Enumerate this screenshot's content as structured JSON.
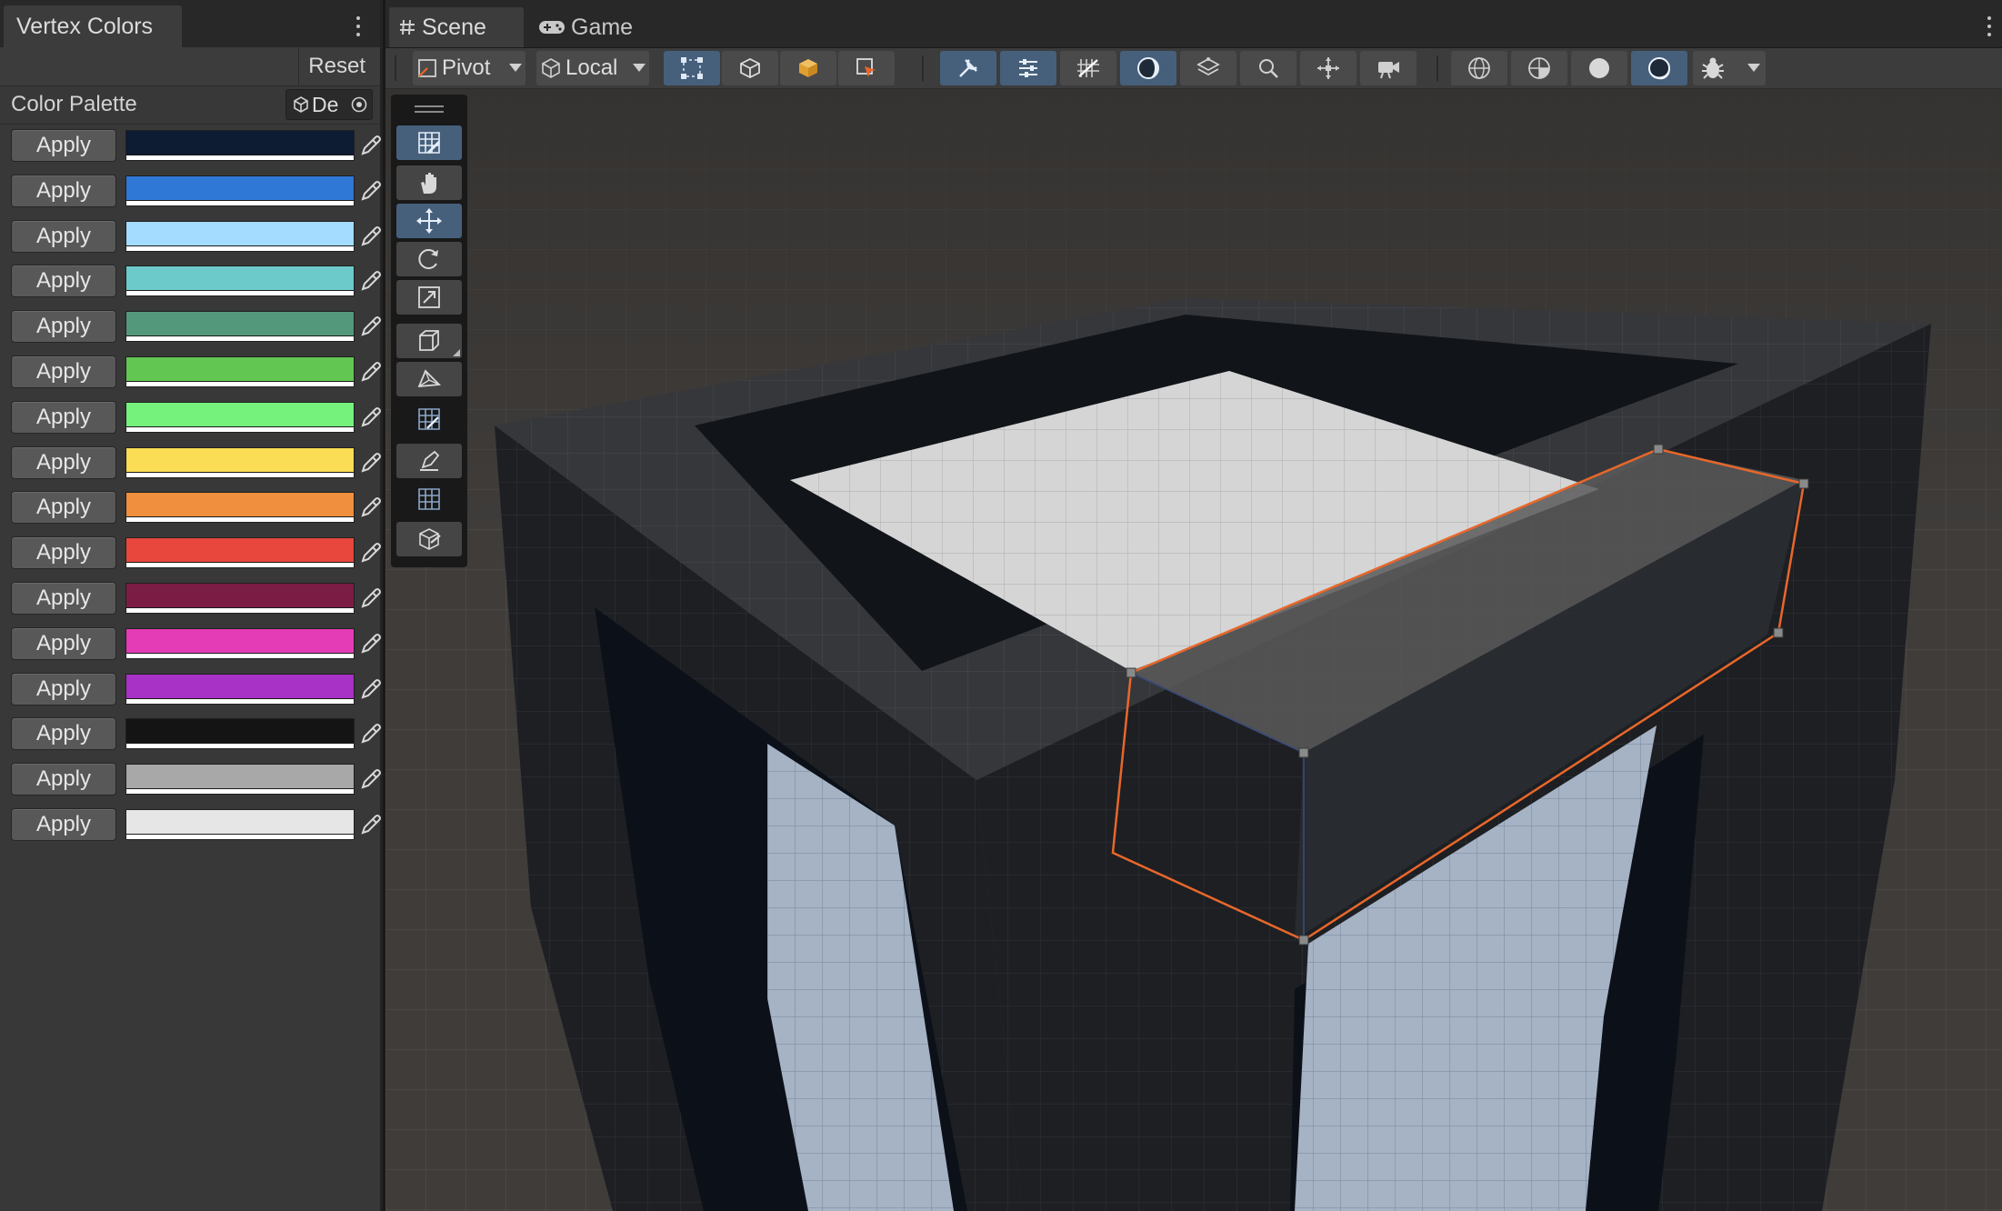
{
  "left_panel": {
    "tab_title": "Vertex Colors",
    "reset_label": "Reset",
    "palette_label": "Color Palette",
    "palette_value": "De",
    "apply_label": "Apply",
    "swatches": [
      {
        "color": "#0d1b33"
      },
      {
        "color": "#2f78d6"
      },
      {
        "color": "#a3dcff"
      },
      {
        "color": "#6ccacb"
      },
      {
        "color": "#53987a"
      },
      {
        "color": "#62c752"
      },
      {
        "color": "#74f27c"
      },
      {
        "color": "#fbdd55"
      },
      {
        "color": "#f08f3e"
      },
      {
        "color": "#e7473c"
      },
      {
        "color": "#7a1c44"
      },
      {
        "color": "#e43cb6"
      },
      {
        "color": "#a831c6"
      },
      {
        "color": "#141414"
      },
      {
        "color": "#a8a8a8"
      },
      {
        "color": "#e6e6e6"
      }
    ]
  },
  "scene_tabs": {
    "scene_label": "Scene",
    "game_label": "Game"
  },
  "toolbar": {
    "pivot_label": "Pivot",
    "local_label": "Local"
  },
  "colors": {
    "accent_blue": "#46607c",
    "selection_orange": "#e8672a",
    "panel_bg": "#383838"
  }
}
